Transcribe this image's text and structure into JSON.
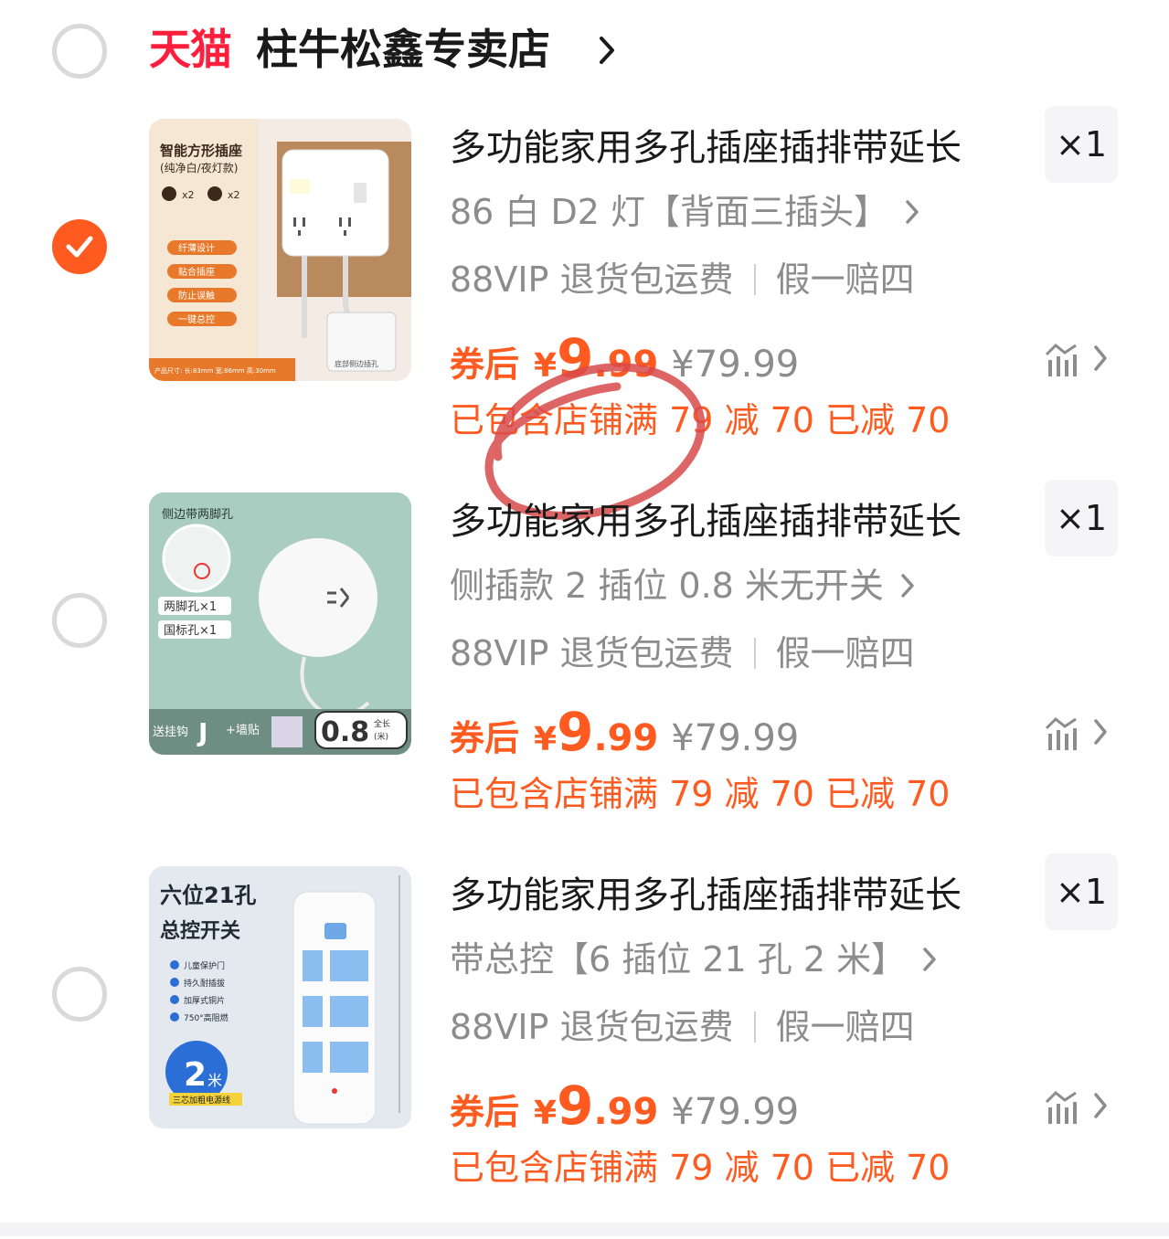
{
  "shop": {
    "platform_logo": "天猫",
    "name": "柱牛松鑫专卖店",
    "selected": false
  },
  "items": [
    {
      "selected": true,
      "title": "多功能家用多孔插座插排带延长",
      "quantity": "×1",
      "sku": "86 白 D2 灯【背面三插头】",
      "tag_left": "88VIP 退货包运费",
      "tag_right": "假一赔四",
      "price_label": "券后",
      "price_currency": "¥",
      "price_integer": "9",
      "price_decimal": ".99",
      "original_price": "¥79.99",
      "discount_text": "已包含店铺满 79 减 70 已减 70",
      "image": {
        "heading": "智能方形插座",
        "subheading": "(纯净白/夜灯款)",
        "badges": [
          "x2",
          "x2"
        ],
        "features": [
          "纤薄设计",
          "贴合插座",
          "防止误触",
          "一键总控"
        ],
        "size_note": "产品尺寸: 长:83mm 宽:86mm 高:30mm",
        "inset_label": "底部侧边插孔"
      }
    },
    {
      "selected": false,
      "title": "多功能家用多孔插座插排带延长",
      "quantity": "×1",
      "sku": "侧插款 2 插位 0.8 米无开关",
      "tag_left": "88VIP 退货包运费",
      "tag_right": "假一赔四",
      "price_label": "券后",
      "price_currency": "¥",
      "price_integer": "9",
      "price_decimal": ".99",
      "original_price": "¥79.99",
      "discount_text": "已包含店铺满 79 减 70 已减 70",
      "image": {
        "heading": "侧边带两脚孔",
        "labels": [
          "两脚孔×1",
          "国标孔×1"
        ],
        "bottom_left": "送挂钩",
        "bottom_mid": "+墙贴",
        "length": "0.8",
        "length_unit_top": "全长",
        "length_unit_bottom": "(米)"
      }
    },
    {
      "selected": false,
      "title": "多功能家用多孔插座插排带延长",
      "quantity": "×1",
      "sku": "带总控【6 插位 21 孔 2 米】",
      "tag_left": "88VIP 退货包运费",
      "tag_right": "假一赔四",
      "price_label": "券后",
      "price_currency": "¥",
      "price_integer": "9",
      "price_decimal": ".99",
      "original_price": "¥79.99",
      "discount_text": "已包含店铺满 79 减 70 已减 70",
      "image": {
        "heading1": "六位21孔",
        "heading2": "总控开关",
        "features": [
          "儿童保护门",
          "持久耐插拔",
          "加厚式铜片",
          "750°高阻燃"
        ],
        "badge_number": "2",
        "badge_unit": "米",
        "badge_caption": "三芯加粗电源线"
      }
    }
  ],
  "colors": {
    "accent": "#ff5a1f",
    "tmall_red": "#ff1e3c",
    "muted_text": "#8c8c8c",
    "annotation_red": "#d84a4a"
  }
}
